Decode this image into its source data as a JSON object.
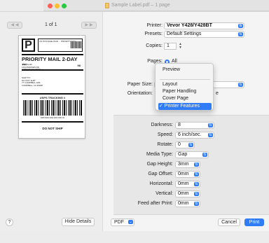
{
  "window": {
    "title": "Sample Label.pdf – 1 page"
  },
  "preview": {
    "page_count": "1 of 1",
    "hide_details": "Hide Details",
    "help": "?"
  },
  "label": {
    "letter": "P",
    "postage": "US POSTAGE PAID ... PRIORITY MAIL",
    "service": "PRIORITY MAIL 2-DAY ™",
    "from_lines": [
      "John Smith",
      "1234 BARNES RD",
      "CARSON NV 00000"
    ],
    "code": "98",
    "ship_to_label": "SHIP TO:",
    "to_lines": [
      "DO NOT SHIP",
      "77 CAMPBELL AVE",
      "CAMPBELL CA 95008"
    ],
    "tracking_title": "USPS TRACKING #",
    "barcode_number": "9405 5000 0000 0000 0000 00",
    "footer": "DO NOT SHIP"
  },
  "settings": {
    "printer_label": "Printer:",
    "printer_value": "Vevor Y428/Y428BT",
    "presets_label": "Presets:",
    "presets_value": "Default Settings",
    "copies_label": "Copies:",
    "copies_value": "1",
    "pages_label": "Pages:",
    "pages_value": "All",
    "paper_size_label": "Paper Size:",
    "paper_size_value": "4",
    "orientation_label": "Orientation:",
    "orientation_suffix": "e"
  },
  "menu": {
    "items": [
      {
        "label": "Preview",
        "selected": false
      },
      {
        "label": "Layout",
        "selected": false
      },
      {
        "label": "Paper Handling",
        "selected": false
      },
      {
        "label": "Cover Page",
        "selected": false
      },
      {
        "label": "✓ Printer Features",
        "selected": true
      }
    ]
  },
  "features": [
    {
      "label": "Darkness:",
      "value": "8"
    },
    {
      "label": "Speed:",
      "value": "6 inch/sec."
    },
    {
      "label": "Rotate:",
      "value": "0"
    },
    {
      "label": "Media Type:",
      "value": "Gap"
    },
    {
      "label": "Gap Height:",
      "value": "3mm"
    },
    {
      "label": "Gap Offset:",
      "value": "0mm"
    },
    {
      "label": "Horizontal:",
      "value": "0mm"
    },
    {
      "label": "Vertical:",
      "value": "0mm"
    },
    {
      "label": "Feed after Print:",
      "value": "0mm"
    }
  ],
  "footer": {
    "pdf": "PDF",
    "cancel": "Cancel",
    "print": "Print"
  },
  "colors": {
    "accent": "#2f7cf6",
    "close": "#ff5f57",
    "minimize": "#febc2e",
    "maximize": "#28c840"
  }
}
